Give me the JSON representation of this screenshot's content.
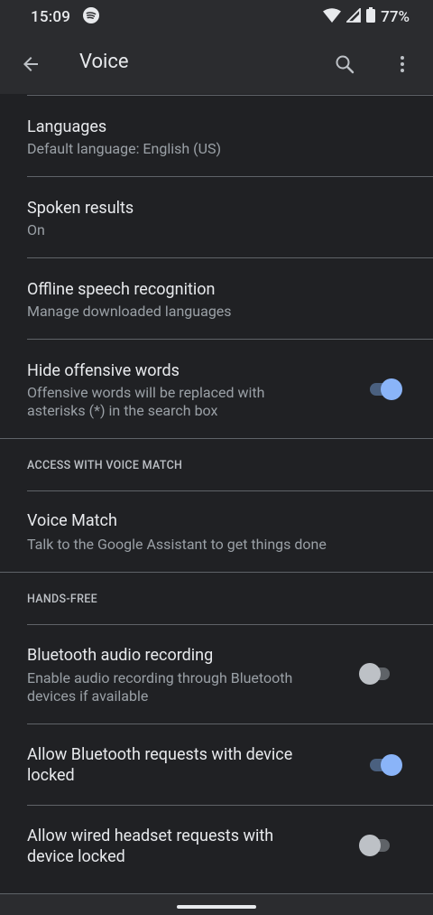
{
  "status": {
    "time": "15:09",
    "battery": "77%"
  },
  "appbar": {
    "title": "Voice"
  },
  "items": {
    "languages": {
      "title": "Languages",
      "subtitle": "Default language: English (US)"
    },
    "spoken": {
      "title": "Spoken results",
      "subtitle": "On"
    },
    "offline": {
      "title": "Offline speech recognition",
      "subtitle": "Manage downloaded languages"
    },
    "offensive": {
      "title": "Hide offensive words",
      "subtitle_1": "Offensive words will be replaced with",
      "subtitle_2": "asterisks (*) in the search box",
      "enabled": true
    },
    "voice_match": {
      "title": "Voice Match",
      "subtitle": "Talk to the Google Assistant to get things done"
    },
    "bt_audio": {
      "title": "Bluetooth audio recording",
      "subtitle_1": "Enable audio recording through Bluetooth",
      "subtitle_2": "devices if available",
      "enabled": false
    },
    "bt_locked": {
      "title_1": "Allow Bluetooth requests with device",
      "title_2": "locked",
      "enabled": true
    },
    "wired_locked": {
      "title_1": "Allow wired headset requests with",
      "title_2": "device locked",
      "enabled": false
    }
  },
  "sections": {
    "voice_match": "ACCESS WITH VOICE MATCH",
    "hands_free": "HANDS-FREE"
  },
  "colors": {
    "accent": "#8ab4f8",
    "background": "#202124",
    "appbar": "#2b2c2f"
  }
}
